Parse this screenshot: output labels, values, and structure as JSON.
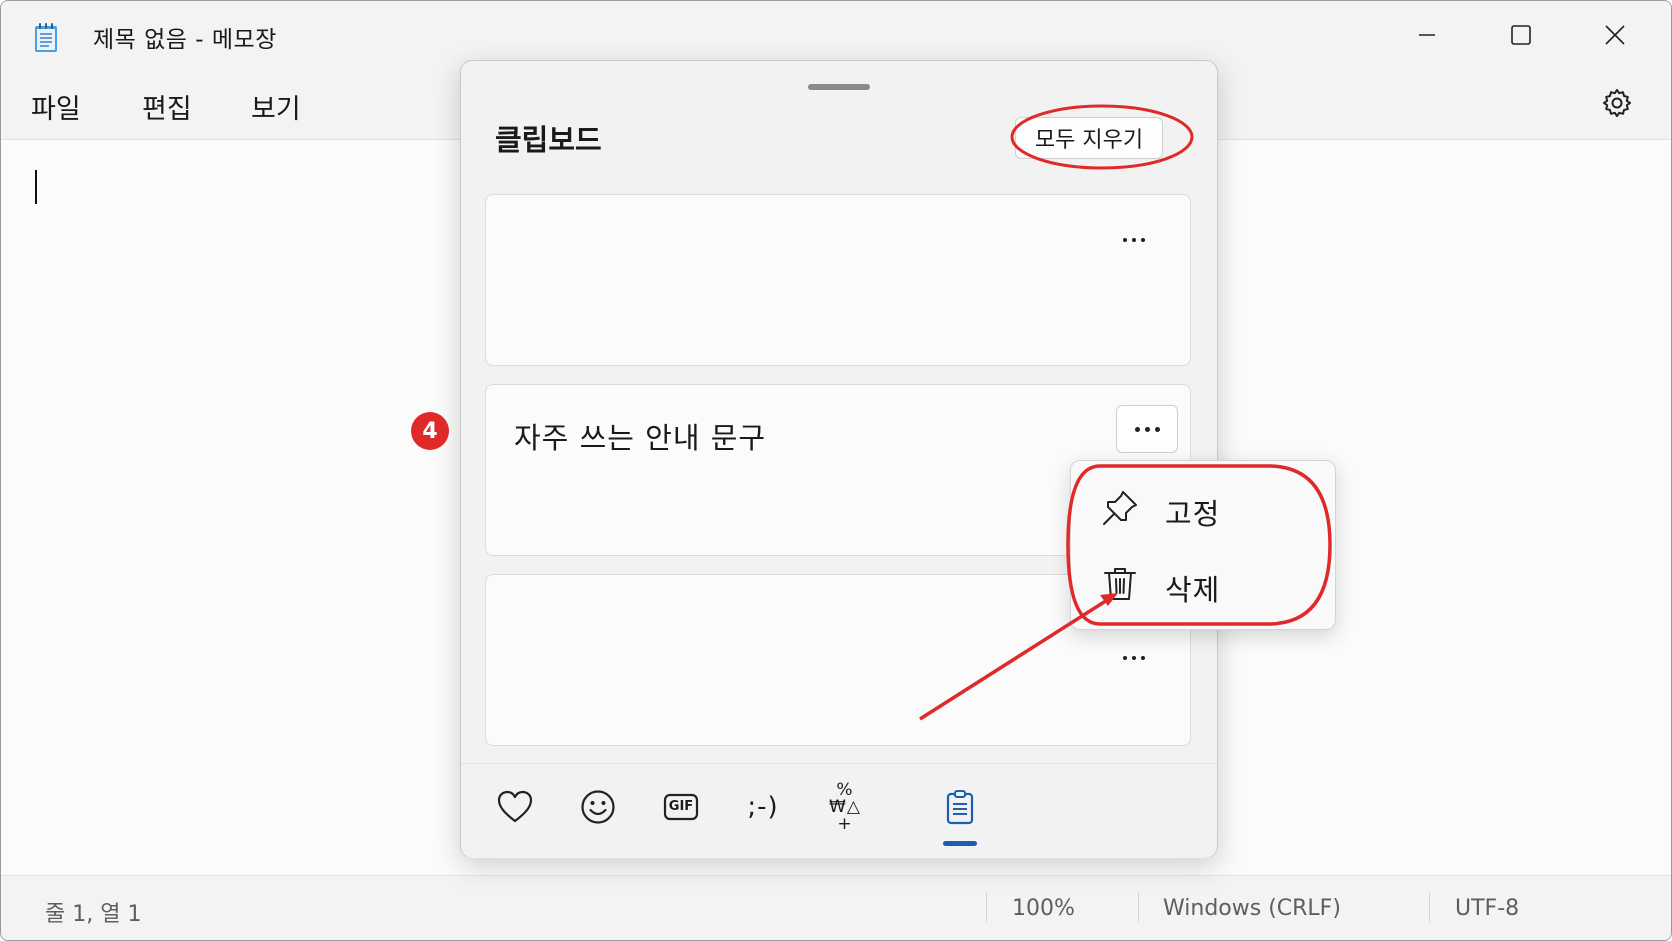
{
  "window": {
    "title": "제목 없음 - 메모장",
    "icons": {
      "app": "notepad-icon",
      "minimize": "minimize-icon",
      "maximize": "maximize-icon",
      "close": "close-icon"
    }
  },
  "menubar": {
    "items": [
      "파일",
      "편집",
      "보기"
    ],
    "settings_icon": "gear-icon"
  },
  "clipboard_panel": {
    "title": "클립보드",
    "clear_all_label": "모두 지우기",
    "items": [
      {
        "text": ""
      },
      {
        "text": "자주 쓰는 안내 문구"
      },
      {
        "text": ""
      }
    ],
    "more_icon": "more-options-icon",
    "context_menu": {
      "pin_label": "고정",
      "delete_label": "삭제",
      "pin_icon": "pin-icon",
      "delete_icon": "trash-icon"
    },
    "tabs": [
      {
        "name": "favorites",
        "icon": "heart-icon",
        "selected": false
      },
      {
        "name": "emoji",
        "icon": "smiley-icon",
        "selected": false
      },
      {
        "name": "gif",
        "icon": "gif-icon",
        "label": "GIF",
        "selected": false
      },
      {
        "name": "kaomoji",
        "icon": "kaomoji-icon",
        "label": ";-)",
        "selected": false
      },
      {
        "name": "symbols",
        "icon": "symbols-icon",
        "label": "%₩△+",
        "selected": false
      },
      {
        "name": "clipboard",
        "icon": "clipboard-icon",
        "selected": true
      }
    ]
  },
  "statusbar": {
    "position": "줄 1, 열 1",
    "zoom": "100%",
    "line_ending": "Windows (CRLF)",
    "encoding": "UTF-8"
  },
  "annotation": {
    "step_number": "4",
    "color": "#e02a2a"
  }
}
